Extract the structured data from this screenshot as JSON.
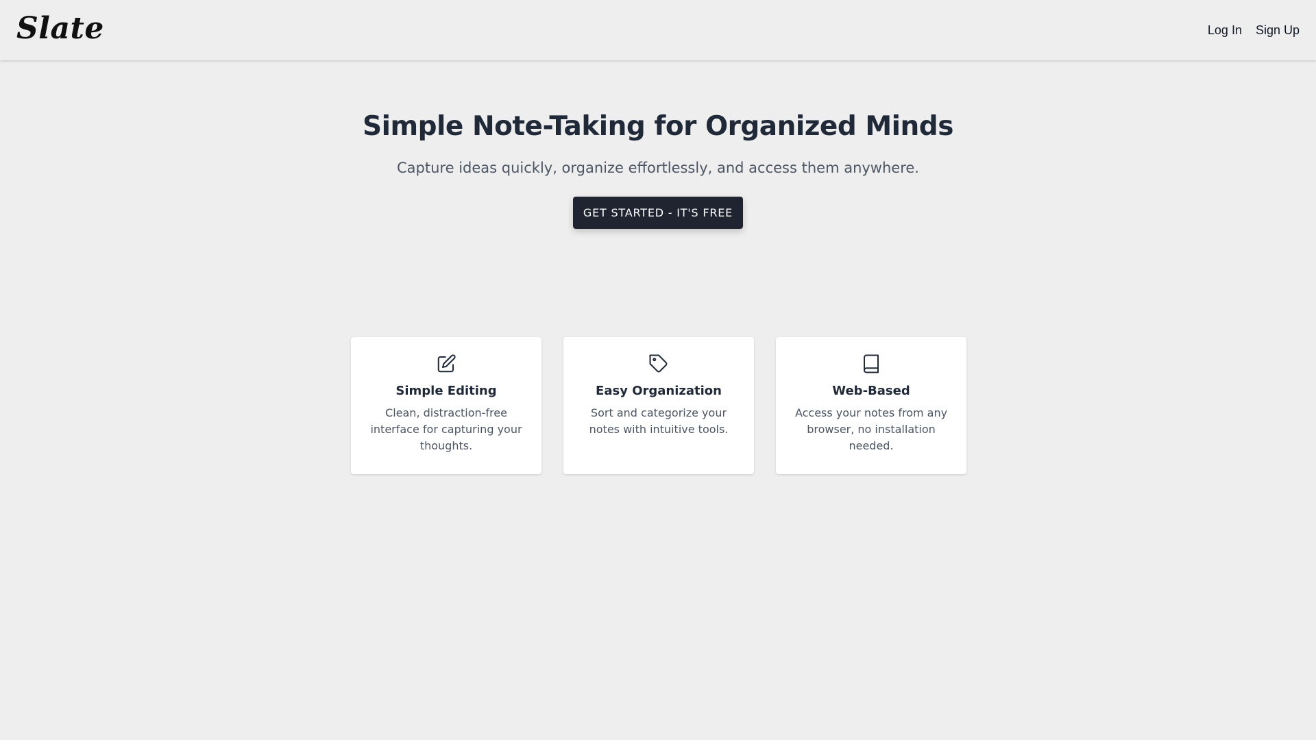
{
  "header": {
    "logo": "Slate",
    "nav": [
      {
        "label": "Log In"
      },
      {
        "label": "Sign Up"
      }
    ]
  },
  "hero": {
    "title": "Simple Note-Taking for Organized Minds",
    "subtitle": "Capture ideas quickly, organize effortlessly, and access them anywhere.",
    "cta_label": "GET STARTED - IT'S FREE"
  },
  "features": [
    {
      "icon": "edit-icon",
      "title": "Simple Editing",
      "description": "Clean, distraction-free interface for capturing your thoughts."
    },
    {
      "icon": "tag-icon",
      "title": "Easy Organization",
      "description": "Sort and categorize your notes with intuitive tools."
    },
    {
      "icon": "book-icon",
      "title": "Web-Based",
      "description": "Access your notes from any browser, no installation needed."
    }
  ],
  "colors": {
    "background": "#eeeeee",
    "cta_background": "#1f2430",
    "heading": "#1f2937",
    "body_text": "#4b5563"
  }
}
